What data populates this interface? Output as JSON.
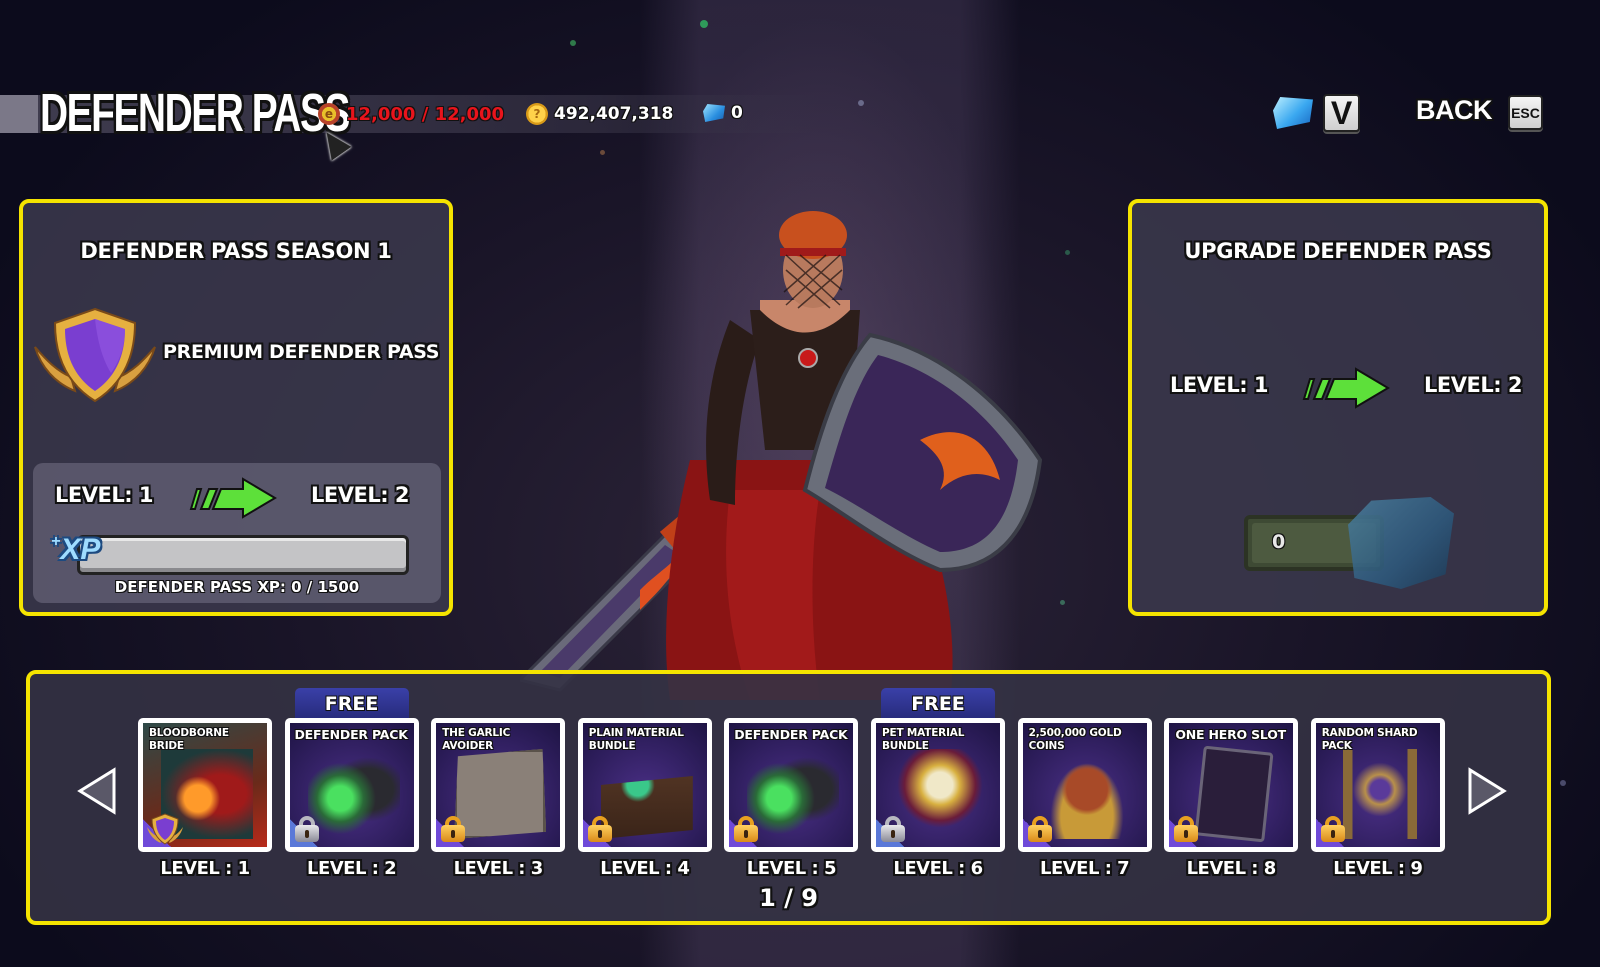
{
  "header": {
    "title": "DEFENDER PASS",
    "currencies": [
      {
        "name": "medals",
        "icon": "medal-coin-icon",
        "value": "12,000 / 12,000",
        "color": "#e8141c"
      },
      {
        "name": "gold",
        "icon": "gold-coin-icon",
        "value": "492,407,318",
        "color": "#ffffff"
      },
      {
        "name": "gems",
        "icon": "gem-icon",
        "value": "0",
        "color": "#ffffff"
      }
    ],
    "shortcut_key": "V",
    "back_label": "BACK",
    "back_key": "ESC"
  },
  "season_panel": {
    "title": "DEFENDER PASS SEASON 1",
    "pass_type": "PREMIUM DEFENDER PASS",
    "level_from": "LEVEL: 1",
    "level_to": "LEVEL: 2",
    "xp_label": "XP",
    "xp_current": 0,
    "xp_max": 1500,
    "xp_progress": 0,
    "xp_text": "DEFENDER PASS XP: 0  /  1500"
  },
  "upgrade_panel": {
    "title": "UPGRADE DEFENDER PASS",
    "level_from": "LEVEL: 1",
    "level_to": "LEVEL: 2",
    "cost_value": "0"
  },
  "rewards": {
    "free_label": "FREE",
    "page_indicator": "1 / 9",
    "items": [
      {
        "name": "BLOODBORNE BRIDE",
        "level": "LEVEL : 1",
        "free": false,
        "lock": "premium-badge"
      },
      {
        "name": "DEFENDER PACK",
        "level": "LEVEL : 2",
        "free": true,
        "lock": "silver"
      },
      {
        "name": "THE GARLIC AVOIDER",
        "level": "LEVEL : 3",
        "free": false,
        "lock": "gold"
      },
      {
        "name": "PLAIN MATERIAL BUNDLE",
        "level": "LEVEL : 4",
        "free": false,
        "lock": "gold"
      },
      {
        "name": "DEFENDER PACK",
        "level": "LEVEL : 5",
        "free": false,
        "lock": "gold"
      },
      {
        "name": "PET MATERIAL BUNDLE",
        "level": "LEVEL : 6",
        "free": true,
        "lock": "silver"
      },
      {
        "name": "2,500,000 GOLD COINS",
        "level": "LEVEL : 7",
        "free": false,
        "lock": "gold"
      },
      {
        "name": "ONE HERO SLOT",
        "level": "LEVEL : 8",
        "free": false,
        "lock": "gold"
      },
      {
        "name": "RANDOM SHARD PACK",
        "level": "LEVEL : 9",
        "free": false,
        "lock": "gold"
      }
    ]
  },
  "colors": {
    "accent_border": "#f5e400",
    "medal_text": "#e8141c",
    "arrow_green": "#5de03a",
    "xp_blue": "#9fdcff"
  }
}
